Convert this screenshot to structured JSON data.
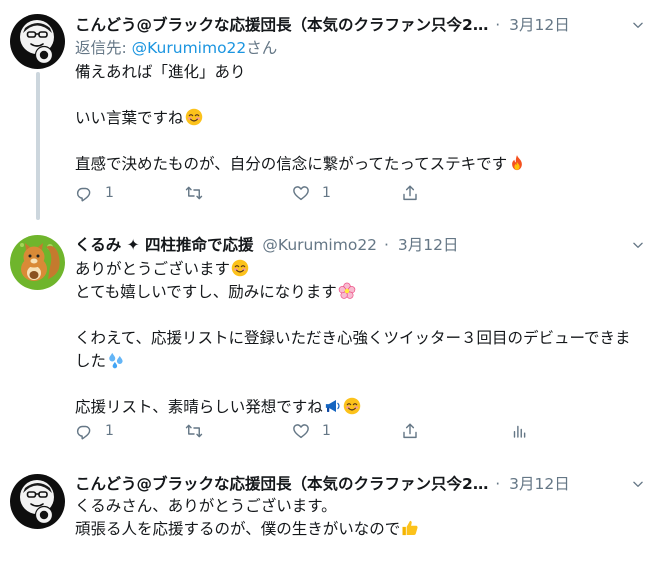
{
  "tweets": [
    {
      "author": "こんどう@ブラックな応援団長（本気のクラファン只今2…",
      "dot": "·",
      "date": "3月12日",
      "reply_prefix": "返信先: ",
      "reply_mention": "@Kurumimo22",
      "reply_suffix": "さん",
      "lines": [
        "備えあれば「進化」あり",
        "いい言葉ですね",
        "直感で決めたものが、自分の信念に繋がってたってステキです"
      ],
      "replies": "1",
      "retweets": "",
      "likes": "1"
    },
    {
      "author": "くるみ ✦ 四柱推命で応援",
      "handle": "@Kurumimo22",
      "dot": "·",
      "date": "3月12日",
      "lines": [
        "ありがとうございます",
        "とても嬉しいですし、励みになります",
        "くわえて、応援リストに登録いただき心強くツイッター３回目のデビューできました",
        "応援リスト、素晴らしい発想ですね"
      ],
      "replies": "1",
      "retweets": "",
      "likes": "1"
    },
    {
      "author": "こんどう@ブラックな応援団長（本気のクラファン只今2…",
      "dot": "·",
      "date": "3月12日",
      "lines": [
        "くるみさん、ありがとうございます。",
        "頑張る人を応援するのが、僕の生きがいなので"
      ]
    }
  ],
  "icons": {
    "reply": "reply-icon",
    "retweet": "retweet-icon",
    "like": "heart-icon",
    "share": "share-icon",
    "analytics": "analytics-icon",
    "more": "chevron-down-icon"
  },
  "colors": {
    "text": "#14171a",
    "secondary": "#657786",
    "link": "#1b95e0",
    "thread": "#ccd6dd"
  }
}
